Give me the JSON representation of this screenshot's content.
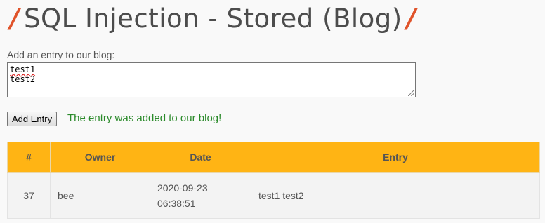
{
  "header": {
    "title": "SQL Injection - Stored (Blog)",
    "slash": "/"
  },
  "form": {
    "label": "Add an entry to our blog:",
    "textarea_line1": "test1",
    "textarea_line2": "test2",
    "button_label": "Add Entry",
    "status_message": "The entry was added to our blog!"
  },
  "table": {
    "columns": [
      "#",
      "Owner",
      "Date",
      "Entry"
    ],
    "rows": [
      {
        "id": "37",
        "owner": "bee",
        "date_line1": "2020-09-23",
        "date_line2": "06:38:51",
        "entry": "test1 test2"
      }
    ]
  },
  "colors": {
    "accent_slash": "#e0532a",
    "table_header": "#ffb414",
    "success_text": "#2a8a2a"
  }
}
